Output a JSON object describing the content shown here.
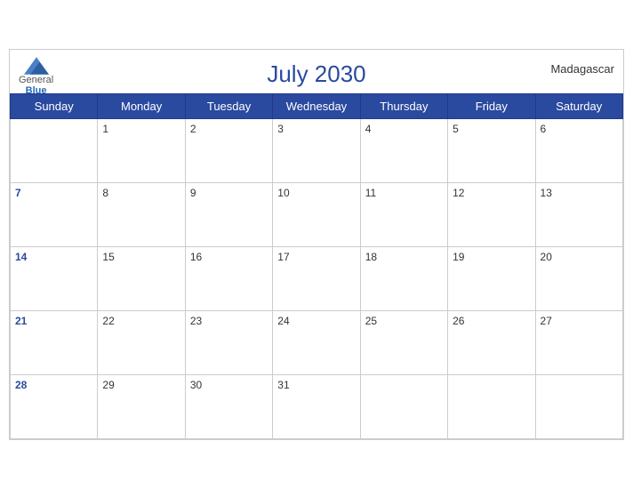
{
  "header": {
    "title": "July 2030",
    "country": "Madagascar",
    "logo": {
      "line1": "General",
      "line2": "Blue"
    }
  },
  "weekdays": [
    "Sunday",
    "Monday",
    "Tuesday",
    "Wednesday",
    "Thursday",
    "Friday",
    "Saturday"
  ],
  "weeks": [
    [
      null,
      1,
      2,
      3,
      4,
      5,
      6
    ],
    [
      7,
      8,
      9,
      10,
      11,
      12,
      13
    ],
    [
      14,
      15,
      16,
      17,
      18,
      19,
      20
    ],
    [
      21,
      22,
      23,
      24,
      25,
      26,
      27
    ],
    [
      28,
      29,
      30,
      31,
      null,
      null,
      null
    ]
  ]
}
